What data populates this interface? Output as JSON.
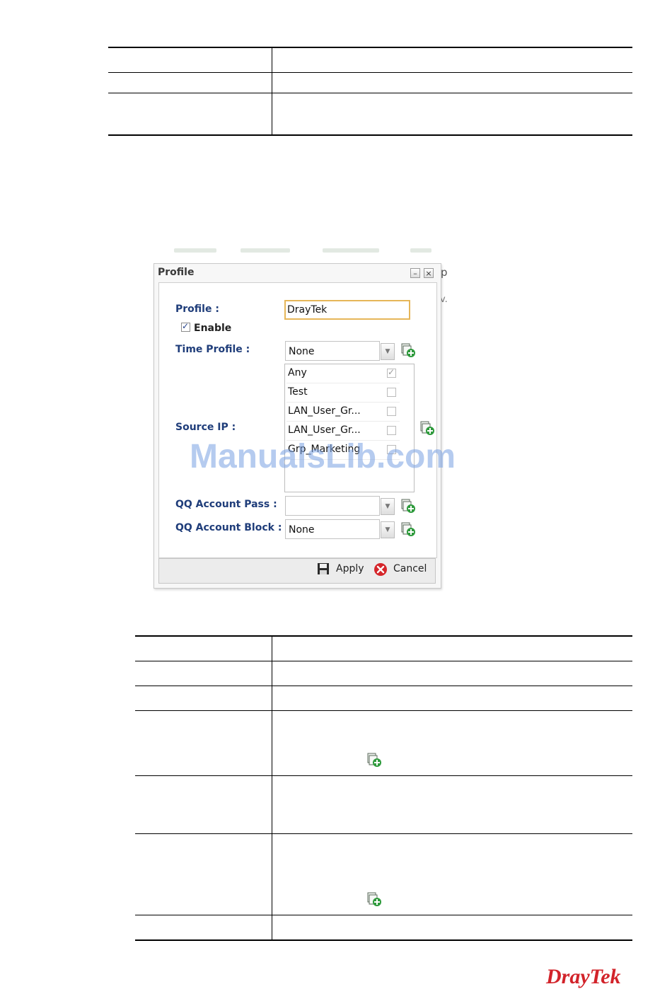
{
  "dialog": {
    "title": "Profile",
    "minimize_glyph": "–",
    "close_glyph": "×",
    "fields": {
      "profile_label": "Profile",
      "profile_value": "DrayTek",
      "enable_label": "Enable",
      "enable_checked": true,
      "time_profile_label": "Time Profile",
      "time_profile_value": "None",
      "source_ip_label": "Source IP",
      "source_ip_items": [
        {
          "label": "Any",
          "checked": true
        },
        {
          "label": "Test",
          "checked": false
        },
        {
          "label": "LAN_User_Gr...",
          "checked": false
        },
        {
          "label": "LAN_User_Gr...",
          "checked": false
        },
        {
          "label": "Grp_Marketing",
          "checked": false
        }
      ],
      "qq_pass_label": "QQ Account Pass",
      "qq_pass_value": "",
      "qq_block_label": "QQ Account Block",
      "qq_block_value": "None",
      "colon": ":"
    },
    "buttons": {
      "apply": "Apply",
      "cancel": "Cancel"
    }
  },
  "background": {
    "partial_text": "p",
    "partial_dot": "v."
  },
  "watermark": "ManualsLib.com",
  "logo": "DrayTek",
  "icons": {
    "add": "add-profile-icon",
    "apply": "floppy-disk-icon",
    "cancel": "red-x-circle-icon"
  },
  "colors": {
    "label_blue": "#1f3d7a",
    "input_focus": "#e6b659",
    "brand_red": "#d2232a",
    "add_green": "#2e9a3c"
  }
}
